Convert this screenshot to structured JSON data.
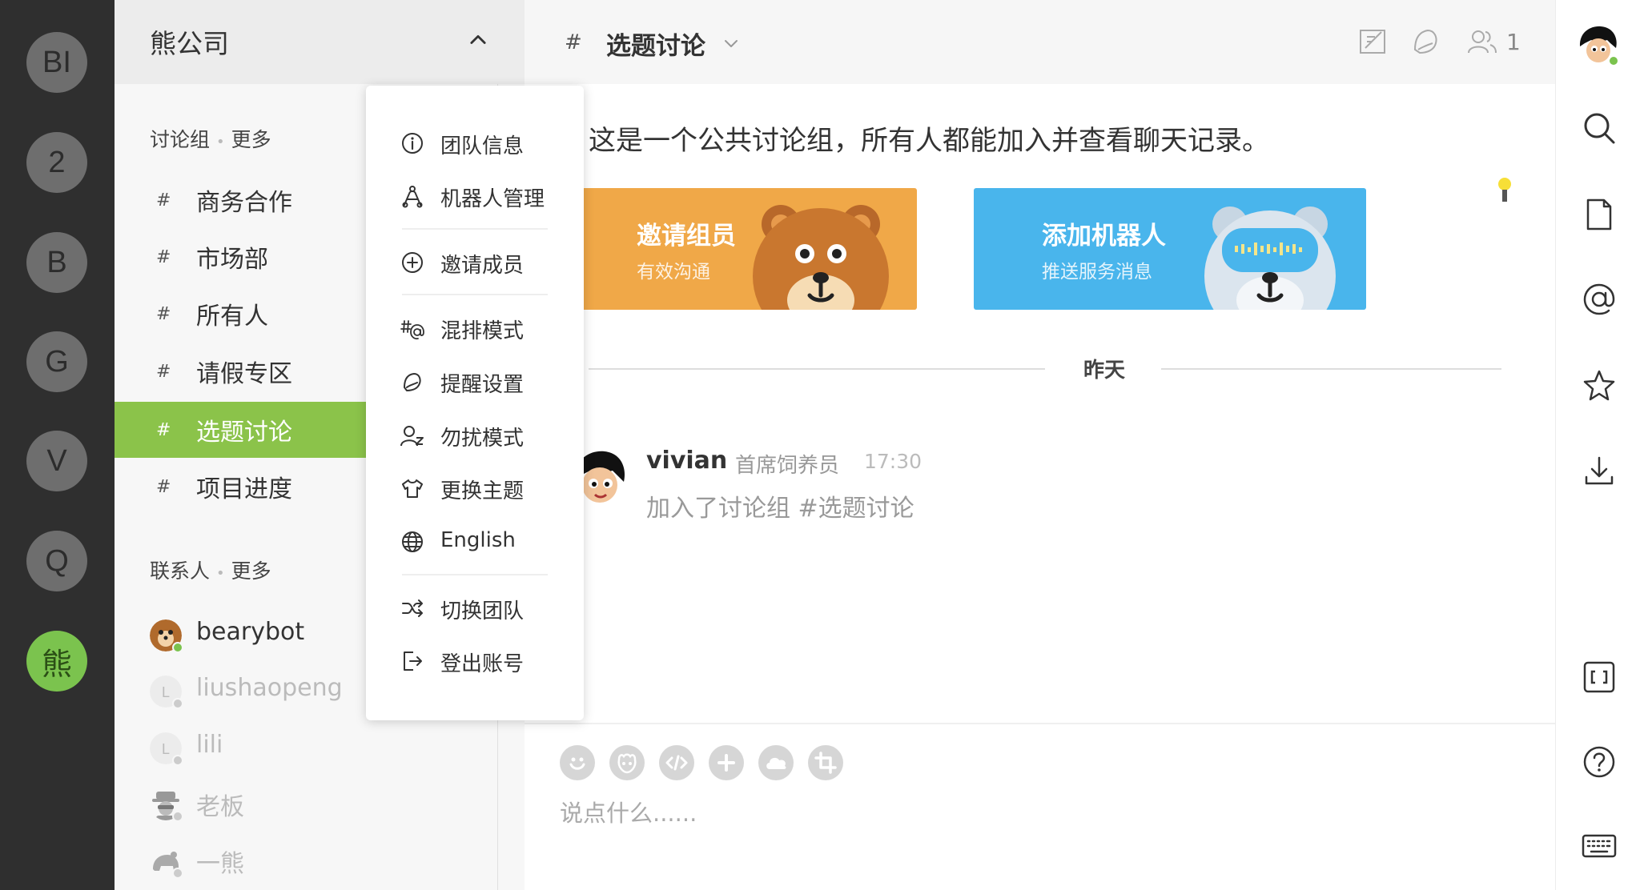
{
  "teams": [
    {
      "label": "BI"
    },
    {
      "label": "2"
    },
    {
      "label": "B"
    },
    {
      "label": "G"
    },
    {
      "label": "V"
    },
    {
      "label": "Q"
    },
    {
      "label": "熊",
      "active": true
    }
  ],
  "sidebar": {
    "team_name": "熊公司",
    "channels_header": "讨论组",
    "contacts_header": "联系人",
    "more_label": "更多",
    "channels": [
      {
        "hash": "#",
        "name": "商务合作"
      },
      {
        "hash": "#",
        "name": "市场部"
      },
      {
        "hash": "#",
        "name": "所有人"
      },
      {
        "hash": "#",
        "name": "请假专区"
      },
      {
        "hash": "#",
        "name": "选题讨论",
        "active": true
      },
      {
        "hash": "#",
        "name": "项目进度"
      }
    ],
    "contacts": [
      {
        "name": "bearybot",
        "status": "online"
      },
      {
        "name": "liushaopeng",
        "status": "offline",
        "initial": "L"
      },
      {
        "name": "lili",
        "status": "offline",
        "initial": "L"
      },
      {
        "name": "老板",
        "status": "offline"
      },
      {
        "name": "一熊",
        "status": "offline"
      }
    ]
  },
  "menu": {
    "items": [
      {
        "label": "团队信息",
        "icon": "info-icon"
      },
      {
        "label": "机器人管理",
        "icon": "robot-icon"
      },
      {
        "label": "邀请成员",
        "icon": "plus-circle-icon"
      },
      {
        "label": "混排模式",
        "icon": "hash-at-icon"
      },
      {
        "label": "提醒设置",
        "icon": "bell-icon"
      },
      {
        "label": "勿扰模式",
        "icon": "snooze-icon"
      },
      {
        "label": "更换主题",
        "icon": "shirt-icon"
      },
      {
        "label": "English",
        "icon": "globe-icon"
      },
      {
        "label": "切换团队",
        "icon": "shuffle-icon"
      },
      {
        "label": "登出账号",
        "icon": "logout-icon"
      }
    ]
  },
  "channel": {
    "hash": "#",
    "title": "选题讨论",
    "member_count": "1",
    "intro": "这是一个公共讨论组，所有人都能加入并查看聊天记录。",
    "cards": [
      {
        "title": "邀请组员",
        "subtitle": "有效沟通"
      },
      {
        "title": "添加机器人",
        "subtitle": "推送服务消息"
      }
    ],
    "date_divider": "昨天",
    "message": {
      "author": "vivian",
      "role": "首席饲养员",
      "time": "17:30",
      "text": "加入了讨论组 #选题讨论"
    }
  },
  "composer": {
    "placeholder": "说点什么......"
  },
  "colors": {
    "accent": "#8bc34a",
    "rail": "#2f2f2f",
    "invite_card": "#f0a848",
    "bot_card": "#49b5ec",
    "online": "#7bc34e"
  }
}
